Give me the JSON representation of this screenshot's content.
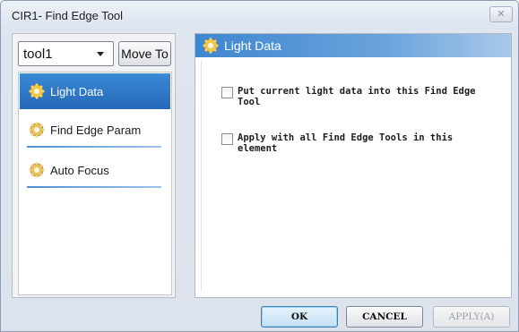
{
  "window": {
    "title": "CIR1- Find Edge Tool",
    "close_glyph": "✕"
  },
  "left_panel": {
    "tool_select": {
      "value": "tool1"
    },
    "move_button": "Move To",
    "nav_items": [
      {
        "label": "Light Data",
        "icon": "gear-icon",
        "active": true
      },
      {
        "label": "Find Edge Param",
        "icon": "gear-icon",
        "active": false
      },
      {
        "label": "Auto Focus",
        "icon": "gear-icon",
        "active": false
      }
    ]
  },
  "right_panel": {
    "header": "Light Data",
    "options": [
      {
        "text": "Put current light data into this Find Edge Tool",
        "checked": false
      },
      {
        "text": "Apply with all Find Edge Tools in this element",
        "checked": false
      }
    ]
  },
  "footer": {
    "ok": "OK",
    "cancel": "CANCEL",
    "apply": "APPLY(A)"
  },
  "colors": {
    "active_nav": "#2f7cd0",
    "header_gradient_start": "#3f86cf",
    "ok_button_border": "#3c7fb1"
  }
}
